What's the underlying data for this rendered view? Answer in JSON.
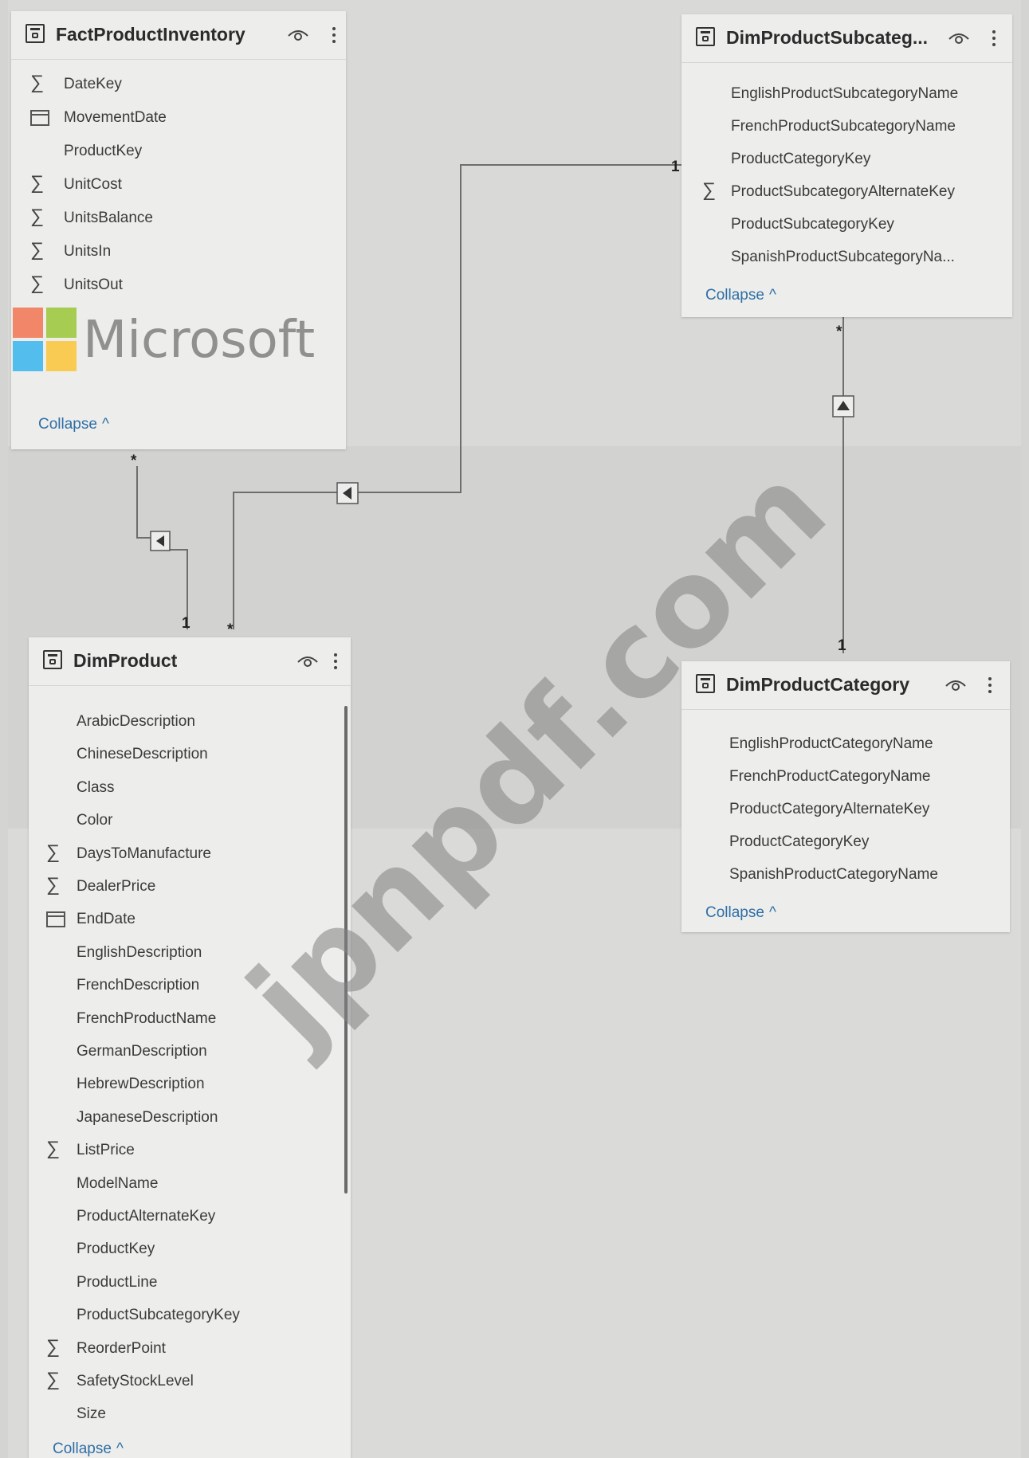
{
  "tables": {
    "fact_inventory": {
      "title": "FactProductInventory",
      "fields": [
        {
          "name": "DateKey",
          "icon": "sigma-icon"
        },
        {
          "name": "MovementDate",
          "icon": "calendar-icon"
        },
        {
          "name": "ProductKey",
          "icon": ""
        },
        {
          "name": "UnitCost",
          "icon": "sigma-icon"
        },
        {
          "name": "UnitsBalance",
          "icon": "sigma-icon"
        },
        {
          "name": "UnitsIn",
          "icon": "sigma-icon"
        },
        {
          "name": "UnitsOut",
          "icon": "sigma-icon"
        }
      ],
      "collapse_label": "Collapse"
    },
    "dim_subcategory": {
      "title": "DimProductSubcateg...",
      "fields": [
        {
          "name": "EnglishProductSubcategoryName",
          "icon": ""
        },
        {
          "name": "FrenchProductSubcategoryName",
          "icon": ""
        },
        {
          "name": "ProductCategoryKey",
          "icon": ""
        },
        {
          "name": "ProductSubcategoryAlternateKey",
          "icon": "sigma-icon"
        },
        {
          "name": "ProductSubcategoryKey",
          "icon": ""
        },
        {
          "name": "SpanishProductSubcategoryNa...",
          "icon": ""
        }
      ],
      "collapse_label": "Collapse"
    },
    "dim_product": {
      "title": "DimProduct",
      "fields": [
        {
          "name": "ArabicDescription",
          "icon": ""
        },
        {
          "name": "ChineseDescription",
          "icon": ""
        },
        {
          "name": "Class",
          "icon": ""
        },
        {
          "name": "Color",
          "icon": ""
        },
        {
          "name": "DaysToManufacture",
          "icon": "sigma-icon"
        },
        {
          "name": "DealerPrice",
          "icon": "sigma-icon"
        },
        {
          "name": "EndDate",
          "icon": "calendar-icon"
        },
        {
          "name": "EnglishDescription",
          "icon": ""
        },
        {
          "name": "FrenchDescription",
          "icon": ""
        },
        {
          "name": "FrenchProductName",
          "icon": ""
        },
        {
          "name": "GermanDescription",
          "icon": ""
        },
        {
          "name": "HebrewDescription",
          "icon": ""
        },
        {
          "name": "JapaneseDescription",
          "icon": ""
        },
        {
          "name": "ListPrice",
          "icon": "sigma-icon"
        },
        {
          "name": "ModelName",
          "icon": ""
        },
        {
          "name": "ProductAlternateKey",
          "icon": ""
        },
        {
          "name": "ProductKey",
          "icon": ""
        },
        {
          "name": "ProductLine",
          "icon": ""
        },
        {
          "name": "ProductSubcategoryKey",
          "icon": ""
        },
        {
          "name": "ReorderPoint",
          "icon": "sigma-icon"
        },
        {
          "name": "SafetyStockLevel",
          "icon": "sigma-icon"
        },
        {
          "name": "Size",
          "icon": ""
        }
      ],
      "collapse_label": "Collapse"
    },
    "dim_category": {
      "title": "DimProductCategory",
      "fields": [
        {
          "name": "EnglishProductCategoryName",
          "icon": ""
        },
        {
          "name": "FrenchProductCategoryName",
          "icon": ""
        },
        {
          "name": "ProductCategoryAlternateKey",
          "icon": ""
        },
        {
          "name": "ProductCategoryKey",
          "icon": ""
        },
        {
          "name": "SpanishProductCategoryName",
          "icon": ""
        }
      ],
      "collapse_label": "Collapse"
    }
  },
  "relationships": {
    "one_label": "1",
    "many_label": "*"
  },
  "watermarks": {
    "brand": "Microsoft",
    "site": "jpnpdf.com"
  },
  "colors": {
    "link": "#2e6fa7",
    "line": "#6e6e6e",
    "ms_red": "#f25022",
    "ms_green": "#7fba00",
    "ms_blue": "#00a4ef",
    "ms_yellow": "#ffb900"
  }
}
